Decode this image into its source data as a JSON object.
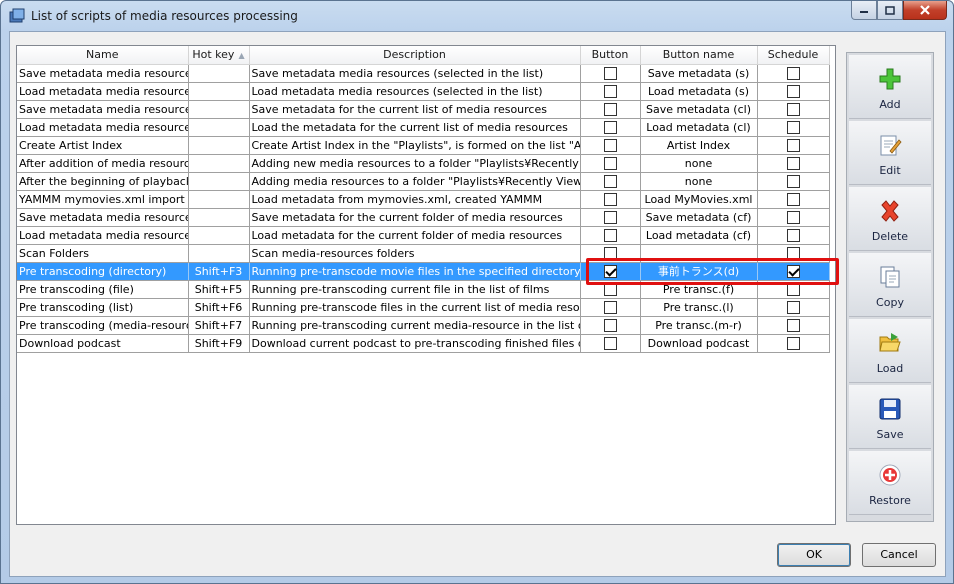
{
  "window": {
    "title": "List of scripts of media resources processing"
  },
  "columns": {
    "name": "Name",
    "hotkey": "Hot key",
    "description": "Description",
    "button": "Button",
    "button_name": "Button name",
    "schedule": "Schedule"
  },
  "rows": [
    {
      "name": "Save metadata media resources (s",
      "hotkey": "",
      "description": "Save metadata media resources (selected in the list)",
      "button": false,
      "button_name": "Save metadata (s)",
      "schedule": false
    },
    {
      "name": "Load metadata media resources (s",
      "hotkey": "",
      "description": "Load metadata media resources (selected in the list)",
      "button": false,
      "button_name": "Load metadata (s)",
      "schedule": false
    },
    {
      "name": "Save metadata media resources (c",
      "hotkey": "",
      "description": "Save metadata for the current list of media resources",
      "button": false,
      "button_name": "Save metadata (cl)",
      "schedule": false
    },
    {
      "name": "Load metadata media resources (c",
      "hotkey": "",
      "description": "Load the metadata for the current list of media resources",
      "button": false,
      "button_name": "Load metadata (cl)",
      "schedule": false
    },
    {
      "name": "Create Artist Index",
      "hotkey": "",
      "description": "Create Artist Index in the \"Playlists\", is formed on the list \"All Music\"",
      "button": false,
      "button_name": "Artist Index",
      "schedule": false
    },
    {
      "name": "After addition of media resource at",
      "hotkey": "",
      "description": "Adding new media resources to a folder \"Playlists¥Recently Added\"",
      "button": false,
      "button_name": "none",
      "schedule": false
    },
    {
      "name": "After the beginning of playback of",
      "hotkey": "",
      "description": "Adding media resources to a folder \"Playlists¥Recently Viewed\" after",
      "button": false,
      "button_name": "none",
      "schedule": false
    },
    {
      "name": "YAMMM mymovies.xml import",
      "hotkey": "",
      "description": "Load metadata from mymovies.xml, created YAMMM",
      "button": false,
      "button_name": "Load MyMovies.xml",
      "schedule": false
    },
    {
      "name": "Save metadata media resources (c",
      "hotkey": "",
      "description": "Save metadata for the current folder of media resources",
      "button": false,
      "button_name": "Save metadata (cf)",
      "schedule": false
    },
    {
      "name": "Load metadata media resources (c",
      "hotkey": "",
      "description": "Load metadata for the current folder of media resources",
      "button": false,
      "button_name": "Load metadata (cf)",
      "schedule": false
    },
    {
      "name": "Scan Folders",
      "hotkey": "",
      "description": "Scan media-resources folders",
      "button": false,
      "button_name": "",
      "schedule": false
    },
    {
      "name": "Pre transcoding (directory)",
      "hotkey": "Shift+F3",
      "description": "Running pre-transcode movie files in the specified directory",
      "button": true,
      "button_name": "事前トランス(d)",
      "schedule": true,
      "selected": true
    },
    {
      "name": "Pre transcoding (file)",
      "hotkey": "Shift+F5",
      "description": "Running pre-transcoding current file in the list of films",
      "button": false,
      "button_name": "Pre transc.(f)",
      "schedule": false
    },
    {
      "name": "Pre transcoding (list)",
      "hotkey": "Shift+F6",
      "description": "Running pre-transcode files in the current list of media resources",
      "button": false,
      "button_name": "Pre transc.(l)",
      "schedule": false
    },
    {
      "name": "Pre transcoding (media-resource)",
      "hotkey": "Shift+F7",
      "description": "Running pre-transcoding current media-resource in the list of films",
      "button": false,
      "button_name": "Pre transc.(m-r)",
      "schedule": false
    },
    {
      "name": "Download podcast",
      "hotkey": "Shift+F9",
      "description": "Download current podcast to pre-transcoding finished files directory",
      "button": false,
      "button_name": "Download podcast",
      "schedule": false
    }
  ],
  "toolbar": {
    "add": "Add",
    "edit": "Edit",
    "delete": "Delete",
    "copy": "Copy",
    "load": "Load",
    "save": "Save",
    "restore": "Restore"
  },
  "footer": {
    "ok": "OK",
    "cancel": "Cancel"
  },
  "colors": {
    "selection": "#3399ff",
    "highlight_box": "#e01010"
  }
}
